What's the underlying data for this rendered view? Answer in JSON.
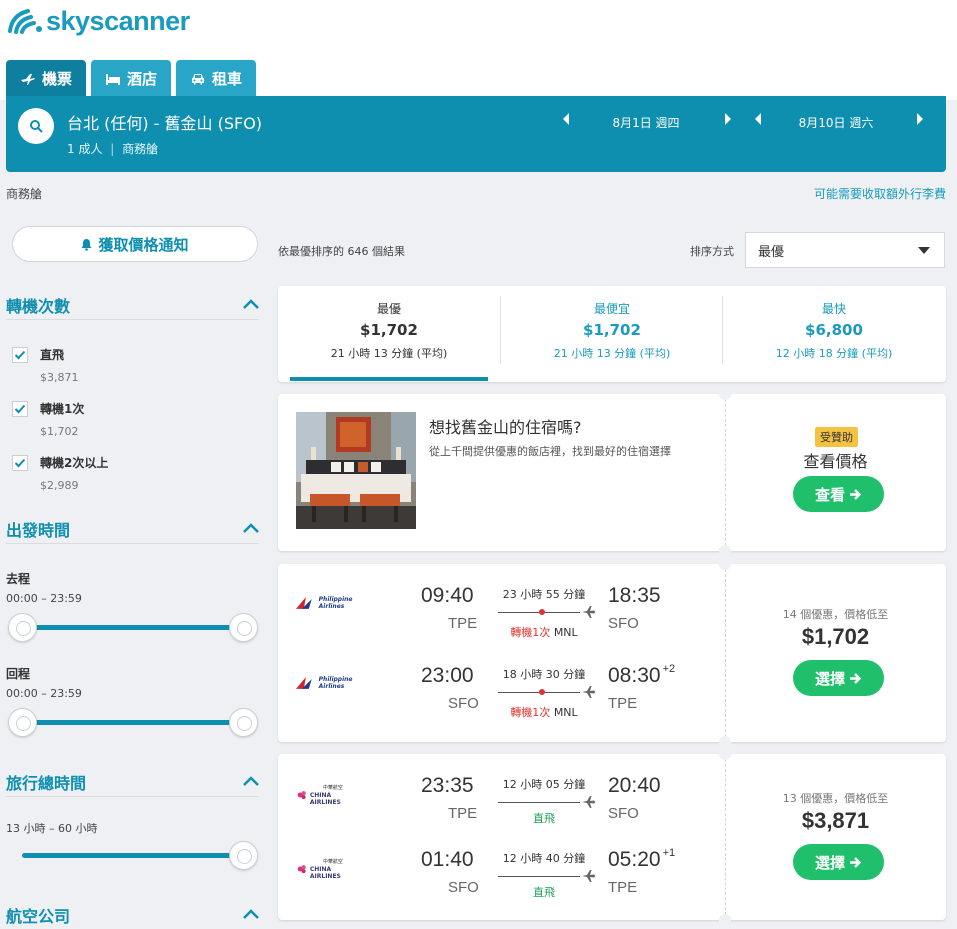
{
  "brand": {
    "name": "skyscanner",
    "color": "#1a9bbd"
  },
  "tabs": [
    {
      "label": "機票",
      "icon": "plane-icon",
      "active": true
    },
    {
      "label": "酒店",
      "icon": "bed-icon",
      "active": false
    },
    {
      "label": "租車",
      "icon": "car-icon",
      "active": false
    }
  ],
  "search": {
    "route": "台北 (任何) - 舊金山 (SFO)",
    "passengers": "1 成人",
    "cabin": "商務艙",
    "depart_date": "8月1日 週四",
    "return_date": "8月10日 週六"
  },
  "notice": {
    "cabin": "商務艙",
    "baggage": "可能需要收取額外行李費"
  },
  "alert_button": "獲取價格通知",
  "filters": {
    "stops": {
      "title": "轉機次數",
      "options": [
        {
          "label": "直飛",
          "price": "$3,871",
          "checked": true
        },
        {
          "label": "轉機1次",
          "price": "$1,702",
          "checked": true
        },
        {
          "label": "轉機2次以上",
          "price": "$2,989",
          "checked": true
        }
      ]
    },
    "times": {
      "title": "出發時間",
      "outbound_label": "去程",
      "outbound_range": "00:00 – 23:59",
      "return_label": "回程",
      "return_range": "00:00 – 23:59"
    },
    "duration": {
      "title": "旅行總時間",
      "range": "13 小時 – 60 小時"
    },
    "airlines": {
      "title": "航空公司"
    }
  },
  "results": {
    "summary": "依最優排序的 646 個結果",
    "sort_label": "排序方式",
    "sort_value": "最優"
  },
  "sort_tabs": [
    {
      "title": "最優",
      "price": "$1,702",
      "duration": "21 小時 13 分鐘 (平均)"
    },
    {
      "title": "最便宜",
      "price": "$1,702",
      "duration": "21 小時 13 分鐘 (平均)"
    },
    {
      "title": "最快",
      "price": "$6,800",
      "duration": "12 小時 18 分鐘 (平均)"
    }
  ],
  "hotel_ad": {
    "title": "想找舊金山的住宿嗎?",
    "description": "從上千間提供優惠的飯店裡，找到最好的住宿選擇",
    "badge": "受贊助",
    "cta_text": "查看價格",
    "button": "查看"
  },
  "flights": [
    {
      "airline": "Philippine Airlines",
      "deals": "14 個優惠，價格低至",
      "price": "$1,702",
      "button": "選擇",
      "legs": [
        {
          "dep_time": "09:40",
          "dep_code": "TPE",
          "arr_time": "18:35",
          "arr_code": "SFO",
          "arr_plus": "",
          "duration": "23 小時 55 分鐘",
          "stops": "轉機1次",
          "via": "MNL"
        },
        {
          "dep_time": "23:00",
          "dep_code": "SFO",
          "arr_time": "08:30",
          "arr_code": "TPE",
          "arr_plus": "+2",
          "duration": "18 小時 30 分鐘",
          "stops": "轉機1次",
          "via": "MNL"
        }
      ]
    },
    {
      "airline": "CHINA AIRLINES",
      "airline_cn": "中華航空",
      "deals": "13 個優惠，價格低至",
      "price": "$3,871",
      "button": "選擇",
      "legs": [
        {
          "dep_time": "23:35",
          "dep_code": "TPE",
          "arr_time": "20:40",
          "arr_code": "SFO",
          "arr_plus": "",
          "duration": "12 小時 05 分鐘",
          "stops": "直飛",
          "via": ""
        },
        {
          "dep_time": "01:40",
          "dep_code": "SFO",
          "arr_time": "05:20",
          "arr_code": "TPE",
          "arr_plus": "+1",
          "duration": "12 小時 40 分鐘",
          "stops": "直飛",
          "via": ""
        }
      ]
    }
  ],
  "colors": {
    "primary": "#0f8fb0",
    "tab": "#29a6c7",
    "green": "#1fbf6b",
    "stop_red": "#e0322e",
    "direct_green": "#1fa05a",
    "sponsor": "#f5c342"
  }
}
